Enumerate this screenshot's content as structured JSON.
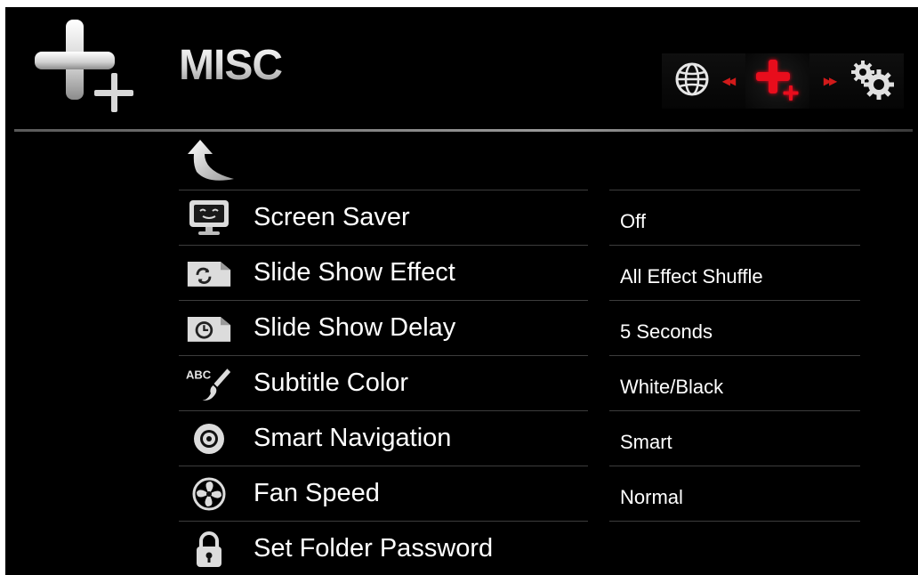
{
  "header": {
    "title": "MISC",
    "icons": [
      "misc-plus-icon",
      "globe-icon",
      "prev-arrow-icon",
      "misc-plus-icon",
      "next-arrow-icon",
      "gears-icon"
    ]
  },
  "back": {
    "icon": "back-arrow-icon"
  },
  "menu": {
    "items": [
      {
        "label": "Screen Saver",
        "value": "Off",
        "icon": "monitor-face-icon"
      },
      {
        "label": "Slide Show Effect",
        "value": "All Effect Shuffle",
        "icon": "slide-refresh-icon"
      },
      {
        "label": "Slide Show Delay",
        "value": "5 Seconds",
        "icon": "slide-clock-icon"
      },
      {
        "label": "Subtitle Color",
        "value": "White/Black",
        "icon": "abc-brush-icon"
      },
      {
        "label": "Smart Navigation",
        "value": "Smart",
        "icon": "disc-icon"
      },
      {
        "label": "Fan Speed",
        "value": "Normal",
        "icon": "fan-icon"
      },
      {
        "label": "Set Folder Password",
        "value": "",
        "icon": "lock-icon"
      }
    ]
  },
  "colors": {
    "background": "#000000",
    "accent": "#e0101e",
    "text": "#ffffff",
    "divider": "#3d3d3d"
  }
}
